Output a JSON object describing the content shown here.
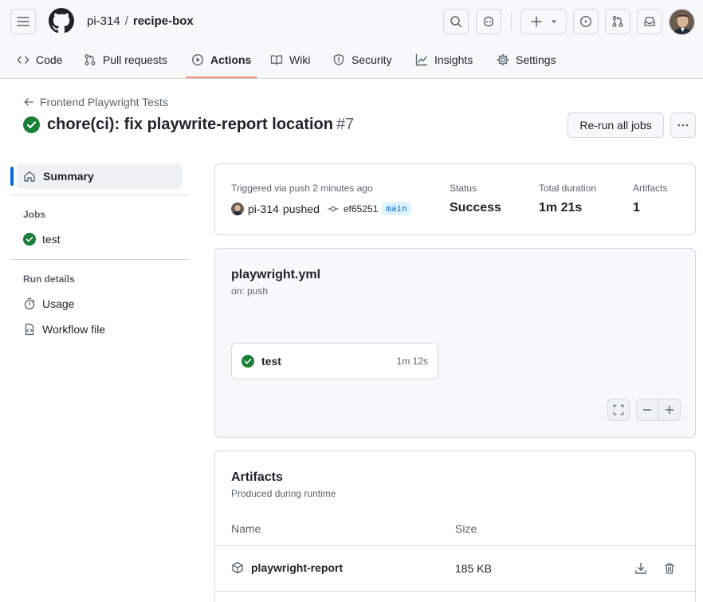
{
  "header": {
    "owner": "pi-314",
    "separator": "/",
    "repo": "recipe-box",
    "tabs": [
      {
        "label": "Code",
        "icon": "code-icon"
      },
      {
        "label": "Pull requests",
        "icon": "git-pull-request-icon"
      },
      {
        "label": "Actions",
        "icon": "play-icon",
        "active": true
      },
      {
        "label": "Wiki",
        "icon": "book-icon"
      },
      {
        "label": "Security",
        "icon": "shield-icon"
      },
      {
        "label": "Insights",
        "icon": "graph-icon"
      },
      {
        "label": "Settings",
        "icon": "gear-icon"
      }
    ]
  },
  "run": {
    "back_label": "Frontend Playwright Tests",
    "title": "chore(ci): fix playwrite-report location",
    "number": "#7",
    "rerun_label": "Re-run all jobs"
  },
  "sidebar": {
    "summary_label": "Summary",
    "jobs_heading": "Jobs",
    "job_label": "test",
    "run_details_heading": "Run details",
    "usage_label": "Usage",
    "workflow_file_label": "Workflow file"
  },
  "summary": {
    "triggered_label": "Triggered via push 2 minutes ago",
    "actor": "pi-314",
    "pushed_label": "pushed",
    "commit": "ef65251",
    "branch": "main",
    "status_label": "Status",
    "status_value": "Success",
    "duration_label": "Total duration",
    "duration_value": "1m 21s",
    "artifacts_label": "Artifacts",
    "artifacts_value": "1"
  },
  "workflow": {
    "file": "playwright.yml",
    "trigger": "on: push",
    "job_name": "test",
    "job_duration": "1m 12s"
  },
  "artifacts": {
    "title": "Artifacts",
    "subtitle": "Produced during runtime",
    "col_name": "Name",
    "col_size": "Size",
    "items": [
      {
        "name": "playwright-report",
        "size": "185 KB"
      }
    ]
  },
  "colors": {
    "success": "#1a7f37",
    "accent": "#0969da",
    "tab_underline": "#fd8c73"
  }
}
